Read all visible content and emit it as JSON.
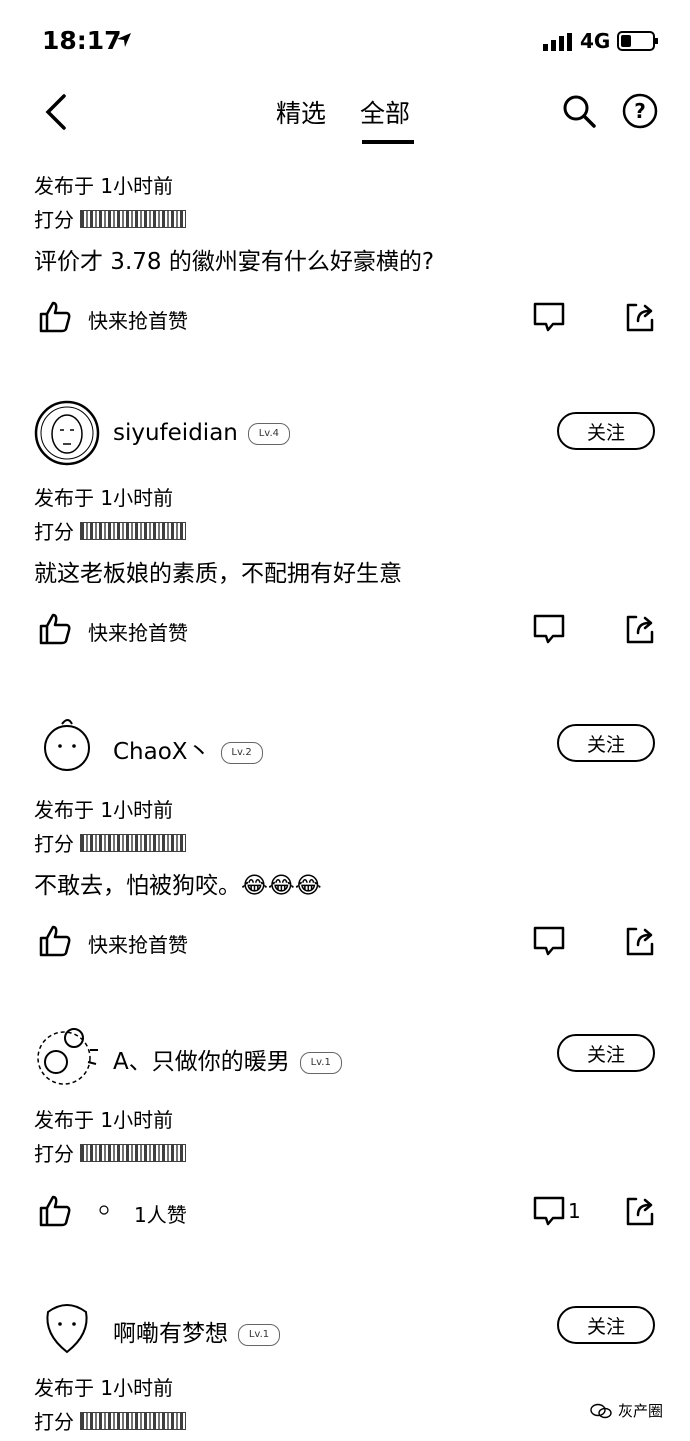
{
  "status": {
    "time": "18:17",
    "network": "4G"
  },
  "nav": {
    "tabs": [
      "精选",
      "全部"
    ],
    "active_tab": "全部"
  },
  "posts": [
    {
      "meta": "发布于 1小时前",
      "rating_label": "打分",
      "text": "评价才 3.78 的徽州宴有什么好豪横的?",
      "like_text": "快来抢首赞"
    },
    {
      "user": {
        "name": "siyufeidian",
        "level": "Lv.4",
        "follow": "关注"
      },
      "meta": "发布于 1小时前",
      "rating_label": "打分",
      "text": "就这老板娘的素质，不配拥有好生意",
      "like_text": "快来抢首赞"
    },
    {
      "user": {
        "name": "ChaoX丶",
        "level": "Lv.2",
        "follow": "关注"
      },
      "meta": "发布于 1小时前",
      "rating_label": "打分",
      "text": "不敢去，怕被狗咬。😂😂😂",
      "like_text": "快来抢首赞"
    },
    {
      "user": {
        "name": "A、只做你的暖男",
        "level": "Lv.1",
        "follow": "关注"
      },
      "meta": "发布于 1小时前",
      "rating_label": "打分",
      "text": "",
      "like_text": "1人赞",
      "comment_count": "1"
    },
    {
      "user": {
        "name": "啊嘞有梦想",
        "level": "Lv.1",
        "follow": "关注"
      },
      "meta": "发布于 1小时前",
      "rating_label": "打分"
    }
  ],
  "watermark": "灰产圈"
}
